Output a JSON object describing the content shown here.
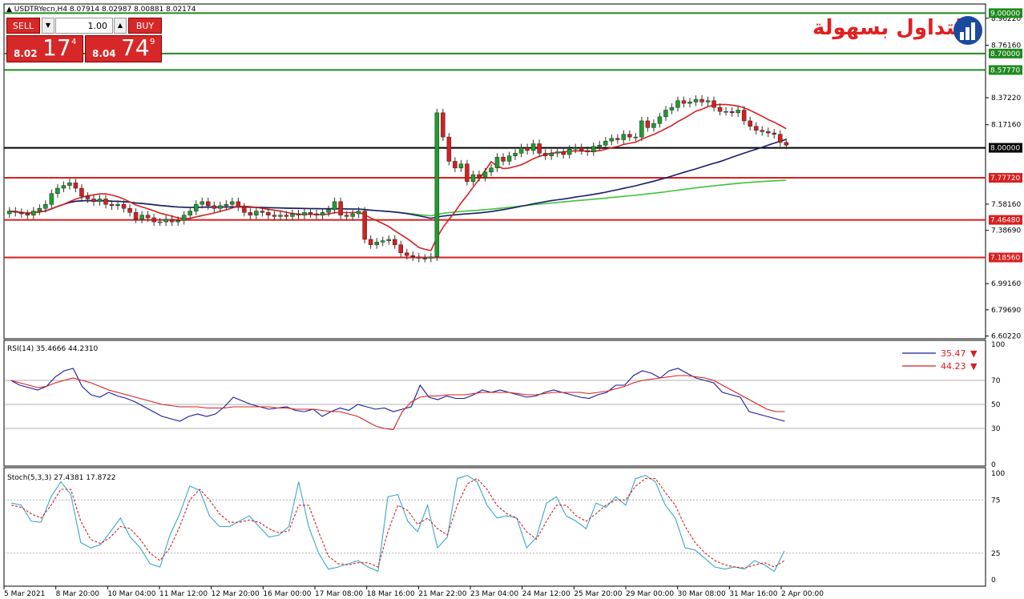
{
  "header": {
    "symbol_line": "USDTRYecn,H4  8.07914 8.02987 8.00881 8.02174"
  },
  "trade_panel": {
    "sell_label": "SELL",
    "buy_label": "BUY",
    "lot": "1.00",
    "sell_small": "8.02",
    "sell_big": "17",
    "sell_sup": "4",
    "buy_small": "8.04",
    "buy_big": "74",
    "buy_sup": "9"
  },
  "logo": {
    "text": "التداول بسهولة"
  },
  "colors": {
    "bull": "#1e9e2e",
    "bear": "#d81f1f",
    "ma_red": "#d81f1f",
    "ma_navy": "#1a1a6e",
    "ma_green": "#3cc43c",
    "rsi_main": "#1a1a9e",
    "stoch_main": "#3aa8c8"
  },
  "chart_data": [
    {
      "type": "candlestick",
      "symbol": "USDTRYecn",
      "timeframe": "H4",
      "ylim": [
        6.6,
        9.05
      ],
      "y_ticks": [
        "8.96220",
        "8.76160",
        "8.37220",
        "8.17160",
        "7.58160",
        "7.38690",
        "6.99160",
        "6.79690",
        "6.60220"
      ],
      "x_labels": [
        "5 Mar 2021",
        "8 Mar 20:00",
        "10 Mar 04:00",
        "11 Mar 12:00",
        "12 Mar 20:00",
        "16 Mar 00:00",
        "17 Mar 08:00",
        "18 Mar 16:00",
        "21 Mar 22:00",
        "23 Mar 04:00",
        "24 Mar 12:00",
        "25 Mar 20:00",
        "29 Mar 00:00",
        "30 Mar 08:00",
        "31 Mar 16:00",
        "2 Apr 00:00"
      ],
      "levels": [
        {
          "value": 9.0,
          "label": "9.00000",
          "color": "#1e8a1e"
        },
        {
          "value": 8.7,
          "label": "8.70000",
          "color": "#1e8a1e"
        },
        {
          "value": 8.5777,
          "label": "8.57770",
          "color": "#1e8a1e"
        },
        {
          "value": 8.0,
          "label": "8.00000",
          "color": "#000000"
        },
        {
          "value": 7.7772,
          "label": "7.77720",
          "color": "#d81f1f"
        },
        {
          "value": 7.4648,
          "label": "7.46480",
          "color": "#d81f1f"
        },
        {
          "value": 7.1856,
          "label": "7.18560",
          "color": "#d81f1f"
        }
      ],
      "close": [
        7.53,
        7.52,
        7.51,
        7.5,
        7.53,
        7.55,
        7.58,
        7.66,
        7.7,
        7.72,
        7.74,
        7.7,
        7.64,
        7.62,
        7.6,
        7.62,
        7.58,
        7.57,
        7.58,
        7.55,
        7.52,
        7.47,
        7.5,
        7.48,
        7.45,
        7.45,
        7.47,
        7.45,
        7.46,
        7.5,
        7.53,
        7.58,
        7.6,
        7.57,
        7.55,
        7.57,
        7.58,
        7.6,
        7.56,
        7.52,
        7.5,
        7.53,
        7.52,
        7.5,
        7.49,
        7.5,
        7.49,
        7.51,
        7.5,
        7.52,
        7.51,
        7.5,
        7.52,
        7.54,
        7.6,
        7.5,
        7.49,
        7.51,
        7.53,
        7.32,
        7.28,
        7.3,
        7.31,
        7.32,
        7.28,
        7.22,
        7.2,
        7.19,
        7.18,
        7.18,
        7.19,
        8.26,
        8.08,
        7.9,
        7.85,
        7.88,
        7.75,
        7.8,
        7.78,
        7.82,
        7.85,
        7.93,
        7.9,
        7.94,
        7.96,
        8.0,
        7.98,
        8.03,
        7.96,
        7.94,
        7.96,
        7.97,
        7.95,
        7.99,
        8.0,
        7.98,
        7.97,
        8.01,
        8.02,
        8.05,
        8.07,
        8.06,
        8.1,
        8.08,
        8.08,
        8.2,
        8.15,
        8.18,
        8.23,
        8.28,
        8.3,
        8.35,
        8.33,
        8.34,
        8.36,
        8.34,
        8.35,
        8.3,
        8.27,
        8.27,
        8.26,
        8.28,
        8.2,
        8.16,
        8.13,
        8.12,
        8.11,
        8.1,
        8.04,
        8.02
      ]
    },
    {
      "type": "line",
      "title": "RSI(14) 35.4666 44.2310",
      "ylim": [
        0,
        100
      ],
      "y_ticks": [
        100,
        70,
        50,
        30,
        0
      ],
      "series": [
        {
          "name": "35.47",
          "values": [
            70,
            66,
            64,
            62,
            65,
            73,
            78,
            80,
            65,
            58,
            56,
            60,
            57,
            55,
            52,
            48,
            44,
            40,
            38,
            36,
            40,
            42,
            40,
            42,
            48,
            56,
            53,
            50,
            48,
            46,
            47,
            48,
            45,
            44,
            46,
            40,
            44,
            47,
            45,
            50,
            48,
            46,
            47,
            44,
            46,
            48,
            66,
            56,
            54,
            57,
            55,
            55,
            58,
            62,
            60,
            62,
            60,
            58,
            56,
            57,
            60,
            62,
            60,
            58,
            56,
            55,
            58,
            60,
            66,
            66,
            74,
            78,
            76,
            72,
            78,
            80,
            76,
            72,
            70,
            68,
            60,
            58,
            56,
            44,
            42,
            40,
            38,
            36
          ]
        },
        {
          "name": "44.23",
          "values": [
            70,
            68,
            66,
            64,
            65,
            68,
            70,
            72,
            70,
            68,
            65,
            62,
            60,
            58,
            56,
            54,
            52,
            50,
            49,
            48,
            48,
            48,
            47,
            47,
            47,
            48,
            48,
            48,
            48,
            48,
            47,
            47,
            46,
            46,
            46,
            45,
            44,
            44,
            42,
            40,
            36,
            32,
            30,
            29,
            44,
            52,
            56,
            57,
            57,
            58,
            58,
            58,
            59,
            60,
            60,
            60,
            60,
            59,
            58,
            58,
            59,
            60,
            60,
            60,
            60,
            59,
            60,
            61,
            63,
            65,
            68,
            70,
            71,
            72,
            73,
            74,
            74,
            73,
            72,
            70,
            66,
            62,
            58,
            54,
            50,
            46,
            44,
            44
          ]
        }
      ]
    },
    {
      "type": "line",
      "title": "Stoch(5,3,3) 27.4381 17.8722",
      "ylim": [
        0,
        100
      ],
      "y_ticks": [
        100,
        75,
        25,
        0
      ],
      "series": [
        {
          "values": [
            72,
            70,
            55,
            54,
            78,
            92,
            80,
            35,
            30,
            33,
            45,
            58,
            40,
            30,
            15,
            12,
            42,
            62,
            88,
            84,
            60,
            50,
            50,
            55,
            60,
            50,
            40,
            42,
            50,
            92,
            50,
            25,
            10,
            12,
            15,
            18,
            12,
            8,
            78,
            80,
            55,
            45,
            70,
            30,
            40,
            95,
            98,
            92,
            70,
            58,
            60,
            58,
            30,
            40,
            72,
            78,
            60,
            55,
            48,
            72,
            68,
            78,
            70,
            95,
            98,
            92,
            70,
            58,
            30,
            28,
            20,
            12,
            10,
            12,
            10,
            18,
            14,
            8,
            27
          ]
        },
        {
          "values": [
            70,
            68,
            62,
            58,
            70,
            85,
            85,
            55,
            38,
            34,
            40,
            50,
            48,
            38,
            25,
            18,
            30,
            50,
            75,
            85,
            75,
            62,
            54,
            54,
            56,
            54,
            48,
            44,
            46,
            70,
            70,
            45,
            22,
            15,
            14,
            16,
            16,
            12,
            45,
            70,
            65,
            52,
            58,
            48,
            42,
            70,
            90,
            95,
            85,
            70,
            62,
            58,
            45,
            38,
            55,
            70,
            70,
            60,
            55,
            62,
            70,
            75,
            75,
            88,
            95,
            95,
            82,
            70,
            50,
            35,
            25,
            18,
            14,
            12,
            11,
            14,
            16,
            12,
            18
          ]
        }
      ]
    }
  ]
}
